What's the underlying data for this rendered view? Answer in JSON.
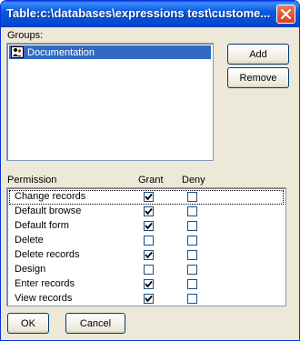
{
  "window": {
    "title": "Table:c:\\databases\\expressions test\\custome..."
  },
  "groups": {
    "label": "Groups:",
    "items": [
      {
        "label": "Documentation",
        "selected": true,
        "icon": "group-icon"
      }
    ]
  },
  "buttons": {
    "add": "Add",
    "remove": "Remove",
    "ok": "OK",
    "cancel": "Cancel"
  },
  "permissions": {
    "headers": {
      "permission": "Permission",
      "grant": "Grant",
      "deny": "Deny"
    },
    "rows": [
      {
        "name": "Change records",
        "grant": true,
        "deny": false,
        "focused": true
      },
      {
        "name": "Default browse",
        "grant": true,
        "deny": false
      },
      {
        "name": "Default form",
        "grant": true,
        "deny": false
      },
      {
        "name": "Delete",
        "grant": false,
        "deny": false
      },
      {
        "name": "Delete records",
        "grant": true,
        "deny": false
      },
      {
        "name": "Design",
        "grant": false,
        "deny": false
      },
      {
        "name": "Enter records",
        "grant": true,
        "deny": false
      },
      {
        "name": "View records",
        "grant": true,
        "deny": false
      }
    ]
  },
  "colors": {
    "title_bar": "#0548d0",
    "selection": "#316ac5",
    "dialog_bg": "#ece9d8"
  }
}
